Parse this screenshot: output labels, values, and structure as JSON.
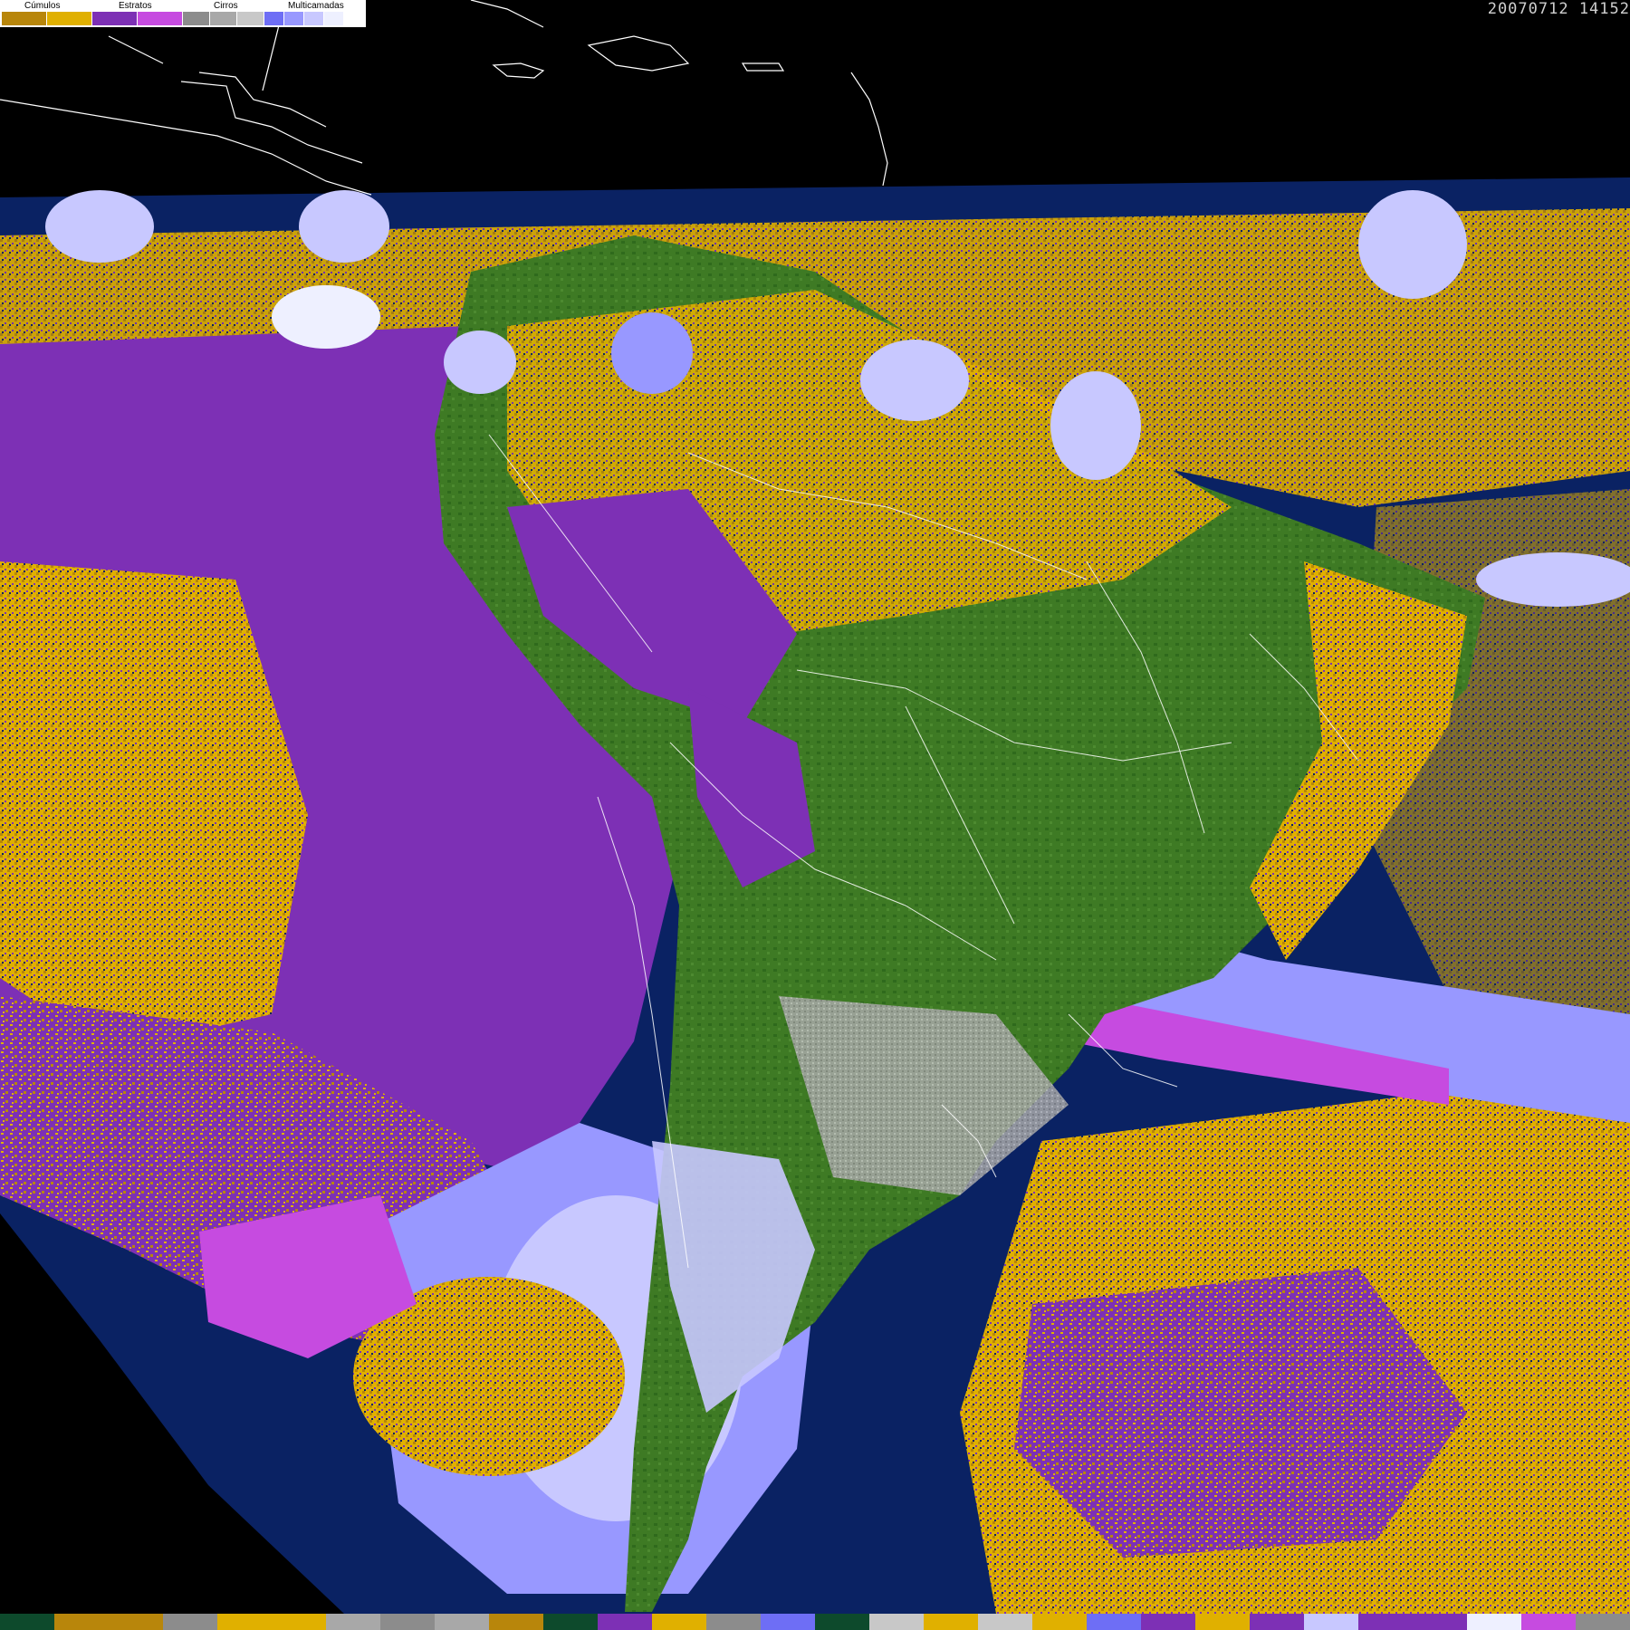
{
  "timestamp": "20070712 14152",
  "colors": {
    "ocean": "#0a2263",
    "cumulus_low": "#b8860b",
    "cumulus_mid": "#e0b000",
    "stratus_low": "#7d30b5",
    "stratus_high": "#c64be0",
    "cirrus_1": "#8c8c8c",
    "cirrus_2": "#a8a8a8",
    "cirrus_3": "#c8c8c8",
    "multi_1": "#6e6ef5",
    "multi_2": "#9898ff",
    "multi_3": "#c8c8ff",
    "multi_4": "#eef0ff",
    "land_dark": "#1e5a16",
    "land_green": "#3e7a24"
  },
  "legend": {
    "groups": [
      {
        "label": "Cúmulos",
        "swatches": [
          "#b8860b",
          "#e0b000"
        ]
      },
      {
        "label": "Estratos",
        "swatches": [
          "#7d30b5",
          "#c64be0"
        ]
      },
      {
        "label": "Cirros",
        "swatches": [
          "#8c8c8c",
          "#a8a8a8",
          "#c8c8c8"
        ]
      },
      {
        "label": "Multicamadas",
        "swatches": [
          "#6e6ef5",
          "#9898ff",
          "#c8c8ff",
          "#eef0ff"
        ]
      }
    ]
  },
  "bottom_bar": [
    "#0d4a2c",
    "#b8860b",
    "#b8860b",
    "#8c8c8c",
    "#e0b000",
    "#e0b000",
    "#a8a8a8",
    "#8c8c8c",
    "#a8a8a8",
    "#b8860b",
    "#0d4a2c",
    "#7d30b5",
    "#e0b000",
    "#8c8c8c",
    "#6e6ef5",
    "#0d4a2c",
    "#c8c8c8",
    "#e0b000",
    "#c8c8c8",
    "#e0b000",
    "#6e6ef5",
    "#7d30b5",
    "#e0b000",
    "#7d30b5",
    "#c8c8ff",
    "#7d30b5",
    "#7d30b5",
    "#eef0ff",
    "#c64be0",
    "#8c8c8c"
  ]
}
